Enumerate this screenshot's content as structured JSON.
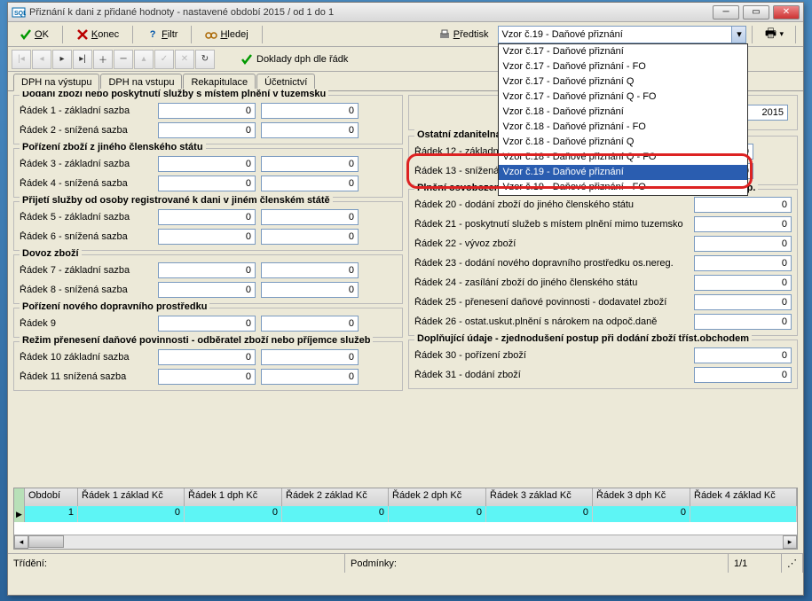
{
  "title": "Přiznání k dani z přidané hodnoty - nastavené období 2015 / od 1 do 1",
  "toolbar": {
    "ok": "OK",
    "konec": "Konec",
    "filtr": "Filtr",
    "hledej": "Hledej",
    "predtisk": "Předtisk",
    "doklady": "Doklady dph dle řádk"
  },
  "combo": {
    "value": "Vzor č.19 - Daňové přiznání",
    "items": [
      "Vzor č.17 - Daňové přiznání",
      "Vzor č.17 - Daňové přiznání - FO",
      "Vzor č.17 - Daňové přiznání Q",
      "Vzor č.17 - Daňové přiznání Q - FO",
      "Vzor č.18 - Daňové přiznání",
      "Vzor č.18 - Daňové přiznání - FO",
      "Vzor č.18 - Daňové přiznání Q",
      "Vzor č.18 - Daňové přiznání Q - FO",
      "Vzor č.19 - Daňové přiznání",
      "Vzor č.19 - Daňové přiznání - FO"
    ],
    "selected_index": 8
  },
  "tabs": [
    "DPH na výstupu",
    "DPH na vstupu",
    "Rekapitulace",
    "Účetnictví"
  ],
  "period": {
    "q": "1",
    "m": "1",
    "year": "2015"
  },
  "groups": {
    "g1": {
      "title": "Dodání zboží nebo poskytnutí služby s místem plnění v tuzemsku",
      "rows": [
        {
          "label": "Řádek 1 - základní sazba",
          "a": "0",
          "b": "0"
        },
        {
          "label": "Řádek 2 - snížená sazba",
          "a": "0",
          "b": "0"
        }
      ]
    },
    "g2": {
      "title": "Pořízení zboží z jiného členského státu",
      "rows": [
        {
          "label": "Řádek 3 - základní sazba",
          "a": "0",
          "b": "0"
        },
        {
          "label": "Řádek 4 - snížená sazba",
          "a": "0",
          "b": "0"
        }
      ]
    },
    "g3": {
      "title": "Přijetí služby od osoby registrované k dani v jiném členském státě",
      "rows": [
        {
          "label": "Řádek 5 - základní sazba",
          "a": "0",
          "b": "0"
        },
        {
          "label": "Řádek 6 - snížená sazba",
          "a": "0",
          "b": "0"
        }
      ]
    },
    "g4": {
      "title": "Dovoz zboží",
      "rows": [
        {
          "label": "Řádek 7 - základní sazba",
          "a": "0",
          "b": "0"
        },
        {
          "label": "Řádek 8 - snížená sazba",
          "a": "0",
          "b": "0"
        }
      ]
    },
    "g5": {
      "title": "Pořízení nového dopravního prostředku",
      "rows": [
        {
          "label": "Řádek 9",
          "a": "0",
          "b": "0"
        }
      ]
    },
    "g6": {
      "title": "Režim přenesení daňové povinnosti - odběratel zboží nebo příjemce služeb",
      "rows": [
        {
          "label": "Řádek 10 základní sazba",
          "a": "0",
          "b": "0"
        },
        {
          "label": "Řádek 11 snížená sazba",
          "a": "0",
          "b": "0"
        }
      ]
    },
    "gR1": {
      "title": "Ostatní zdanitelná plnění, u kterých je povinen přiznat daň plátce",
      "rows": [
        {
          "label": "Řádek 12 - základní sazba",
          "a": "0",
          "b": "0"
        },
        {
          "label": "Řádek 13 - snížená sazba",
          "a": "0",
          "b": "0"
        }
      ]
    },
    "gR2": {
      "title": "Plnění osvobozená a s místem plnění mimo tuzemsko s nárokem na odp.",
      "rows": [
        {
          "label": "Řádek 20 - dodání zboží do jiného členského státu",
          "a": "0"
        },
        {
          "label": "Řádek 21 - poskytnutí služeb s místem plnění mimo tuzemsko",
          "a": "0"
        },
        {
          "label": "Řádek 22 - vývoz zboží",
          "a": "0"
        },
        {
          "label": "Řádek 23 - dodání nového dopravního prostředku os.nereg.",
          "a": "0"
        },
        {
          "label": "Řádek 24 - zasílání zboží do jiného členského státu",
          "a": "0"
        },
        {
          "label": "Řádek 25 - přenesení daňové povinnosti - dodavatel zboží",
          "a": "0"
        },
        {
          "label": "Řádek 26 - ostat.uskut.plnění s nárokem na odpoč.daně",
          "a": "0"
        }
      ]
    },
    "gR3": {
      "title": "Doplňující údaje - zjednodušení postup při dodání zboží tříst.obchodem",
      "rows": [
        {
          "label": "Řádek 30 - pořízení zboží",
          "a": "0"
        },
        {
          "label": "Řádek 31 - dodání zboží",
          "a": "0"
        }
      ]
    }
  },
  "grid": {
    "headers": [
      "Období",
      "Řádek 1 základ Kč",
      "Řádek 1 dph Kč",
      "Řádek 2  základ Kč",
      "Řádek 2 dph Kč",
      "Řádek 3 základ Kč",
      "Řádek 3 dph Kč",
      "Řádek 4 základ Kč"
    ],
    "row": [
      "1",
      "0",
      "0",
      "0",
      "0",
      "0",
      "0",
      ""
    ]
  },
  "status": {
    "trideni": "Třídění:",
    "podminky": "Podmínky:",
    "pos": "1/1"
  }
}
